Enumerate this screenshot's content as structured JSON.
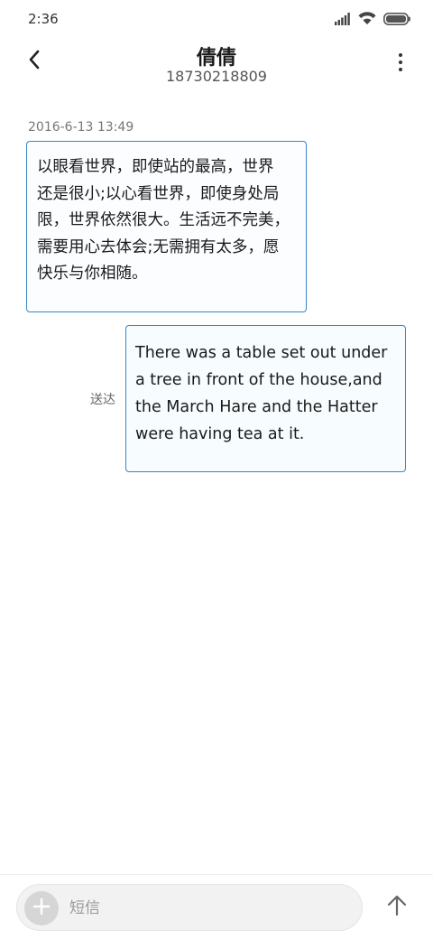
{
  "status_bar": {
    "time": "2:36",
    "icons": [
      "signal-icon",
      "wifi-icon",
      "battery-icon"
    ]
  },
  "header": {
    "title": "倩倩",
    "phone": "18730218809",
    "back_icon": "chevron-left-icon",
    "menu_icon": "more-vertical-icon"
  },
  "conversation": {
    "timestamp": "2016-6-13 13:49",
    "messages": [
      {
        "direction": "incoming",
        "lines": [
          "以眼看世界，即使站的最高，世界",
          "还是很小;以心看世界，即使身处局",
          "限，世界依然很大。生活远不完美，",
          "需要用心去体会;无需拥有太多，愿",
          "快乐与你相随。"
        ]
      },
      {
        "direction": "outgoing",
        "status": "送达",
        "lines": [
          "There was a table set out under",
          "a tree in front of the house,and",
          "the March Hare and the Hatter",
          "were having tea at it."
        ]
      }
    ]
  },
  "compose": {
    "placeholder": "短信",
    "value": "",
    "add_icon": "plus-icon",
    "send_icon": "arrow-up-icon"
  },
  "colors": {
    "bubble_border": "#3a85c6",
    "bubble_background": "#fbfdff"
  }
}
